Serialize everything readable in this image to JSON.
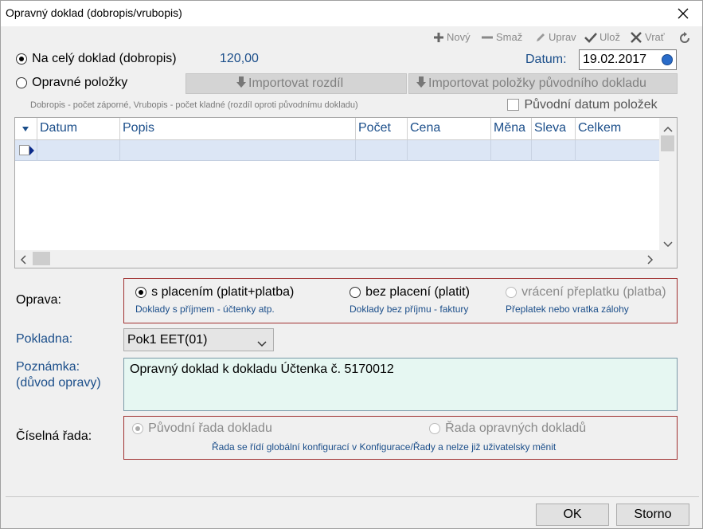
{
  "window": {
    "title": "Opravný doklad (dobropis/vrubopis)"
  },
  "toolbar": {
    "new_label": "Nový",
    "delete_label": "Smaž",
    "edit_label": "Uprav",
    "save_label": "Ulož",
    "revert_label": "Vrať"
  },
  "mode": {
    "whole_document_label": "Na celý doklad (dobropis)",
    "whole_document_amount": "120,00",
    "correction_items_label": "Opravné položky",
    "selected": "whole_document"
  },
  "date": {
    "label": "Datum:",
    "value": "19.02.2017"
  },
  "import": {
    "difference_label": "Importovat rozdíl",
    "original_items_label": "Importovat položky původního dokladu"
  },
  "hint": "Dobropis - počet záporné, Vrubopis - počet kladné (rozdíl oproti původnímu dokladu)",
  "original_date_label": "Původní datum položek",
  "grid": {
    "columns": [
      "Datum",
      "Popis",
      "Počet",
      "Cena",
      "Měna",
      "Sleva",
      "Celkem"
    ]
  },
  "oprava": {
    "label": "Oprava:",
    "options": [
      {
        "label": "s placením (platit+platba)",
        "sub": "Doklady s příjmem - účtenky atp."
      },
      {
        "label": "bez placení (platit)",
        "sub": "Doklady bez příjmu - faktury"
      },
      {
        "label": "vrácení přeplatku (platba)",
        "sub": "Přeplatek nebo vratka zálohy"
      }
    ]
  },
  "pokladna": {
    "label": "Pokladna:",
    "value": "Pok1 EET(01)"
  },
  "poznamka": {
    "label1": "Poznámka:",
    "label2": "(důvod opravy)",
    "value": "Opravný doklad k dokladu Účtenka č. 5170012"
  },
  "ciselna": {
    "label": "Číselná řada:",
    "option1": "Původní řada dokladu",
    "option2": "Řada opravných dokladů",
    "note": "Řada se řídí globální konfigurací v Konfigurace/Řady a nelze již uživatelsky měnit"
  },
  "buttons": {
    "ok": "OK",
    "cancel": "Storno"
  }
}
